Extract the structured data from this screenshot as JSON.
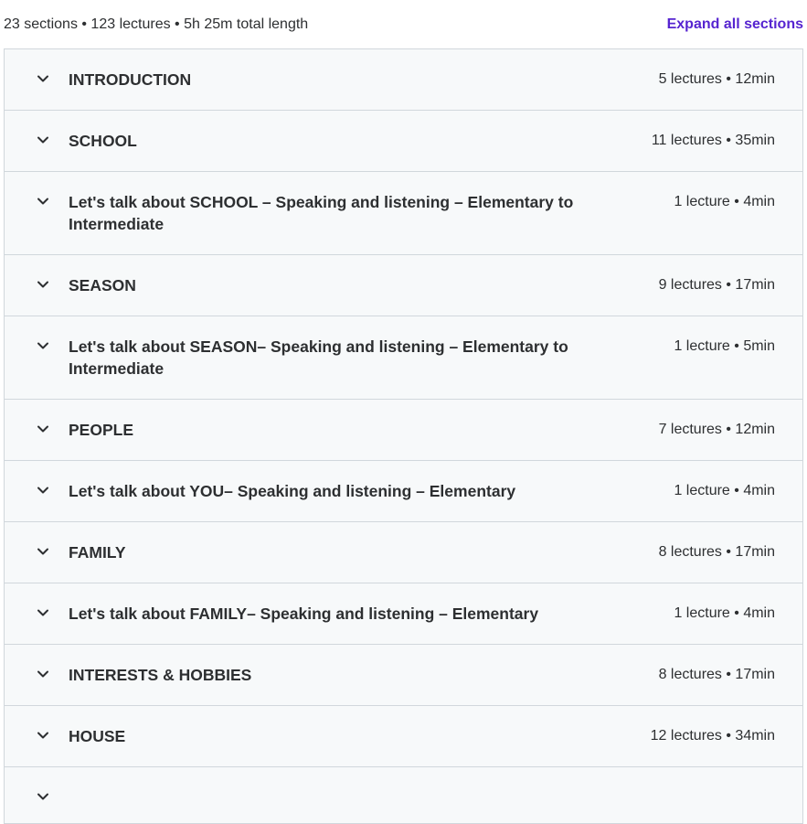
{
  "summary": {
    "text": "23 sections • 123 lectures • 5h 25m total length",
    "expand_label": "Expand all sections"
  },
  "sections": [
    {
      "title": "INTRODUCTION",
      "meta": "5 lectures • 12min"
    },
    {
      "title": "SCHOOL",
      "meta": "11 lectures • 35min"
    },
    {
      "title": "Let's talk about SCHOOL – Speaking and listening – Elementary to Intermediate",
      "meta": "1 lecture • 4min"
    },
    {
      "title": "SEASON",
      "meta": "9 lectures • 17min"
    },
    {
      "title": "Let's talk about SEASON– Speaking and listening – Elementary to Intermediate",
      "meta": "1 lecture • 5min"
    },
    {
      "title": "PEOPLE",
      "meta": "7 lectures • 12min"
    },
    {
      "title": "Let's talk about YOU– Speaking and listening – Elementary",
      "meta": "1 lecture • 4min"
    },
    {
      "title": "FAMILY",
      "meta": "8 lectures • 17min"
    },
    {
      "title": "Let's talk about FAMILY– Speaking and listening – Elementary",
      "meta": "1 lecture • 4min"
    },
    {
      "title": "INTERESTS & HOBBIES",
      "meta": "8 lectures • 17min"
    },
    {
      "title": "HOUSE",
      "meta": "12 lectures • 34min"
    },
    {
      "title": "",
      "meta": ""
    }
  ],
  "icons": {
    "chevron": "chevron-down-icon"
  },
  "colors": {
    "accent": "#5624d0",
    "text": "#2d2f31",
    "section_bg": "#f7f9fa",
    "border": "#d1d7dc"
  }
}
